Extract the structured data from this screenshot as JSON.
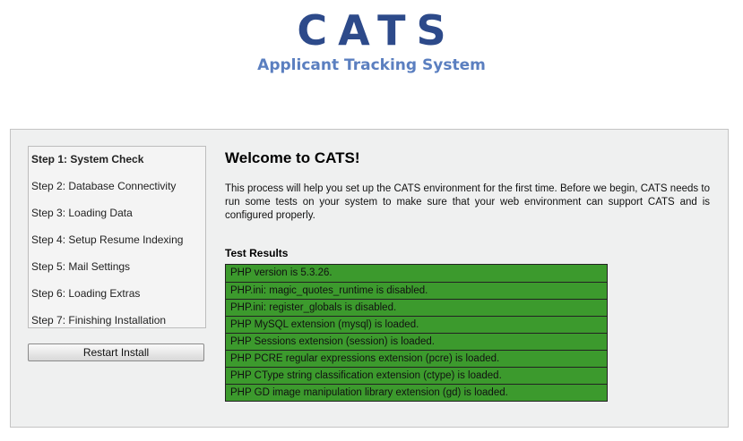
{
  "header": {
    "title": "CATS",
    "subtitle": "Applicant Tracking System"
  },
  "steps": [
    {
      "label": "Step 1: System Check",
      "current": true
    },
    {
      "label": "Step 2: Database Connectivity",
      "current": false
    },
    {
      "label": "Step 3: Loading Data",
      "current": false
    },
    {
      "label": "Step 4: Setup Resume Indexing",
      "current": false
    },
    {
      "label": "Step 5: Mail Settings",
      "current": false
    },
    {
      "label": "Step 6: Loading Extras",
      "current": false
    },
    {
      "label": "Step 7: Finishing Installation",
      "current": false
    }
  ],
  "restart_button": "Restart Install",
  "main": {
    "heading": "Welcome to CATS!",
    "intro": "This process will help you set up the CATS environment for the first time. Before we begin, CATS needs to run some tests on your system to make sure that your web environment can support CATS and is configured properly.",
    "results_title": "Test Results",
    "results": [
      "PHP version is 5.3.26.",
      "PHP.ini: magic_quotes_runtime is disabled.",
      "PHP.ini: register_globals is disabled.",
      "PHP MySQL extension (mysql) is loaded.",
      "PHP Sessions extension (session) is loaded.",
      "PHP PCRE regular expressions extension (pcre) is loaded.",
      "PHP CType string classification extension (ctype) is loaded.",
      "PHP GD image manipulation library extension (gd) is loaded."
    ]
  },
  "colors": {
    "logo": "#2d4a8a",
    "subtitle": "#5b7fc0",
    "panel_bg": "#eff0f0",
    "test_pass": "#3c9a2d"
  }
}
